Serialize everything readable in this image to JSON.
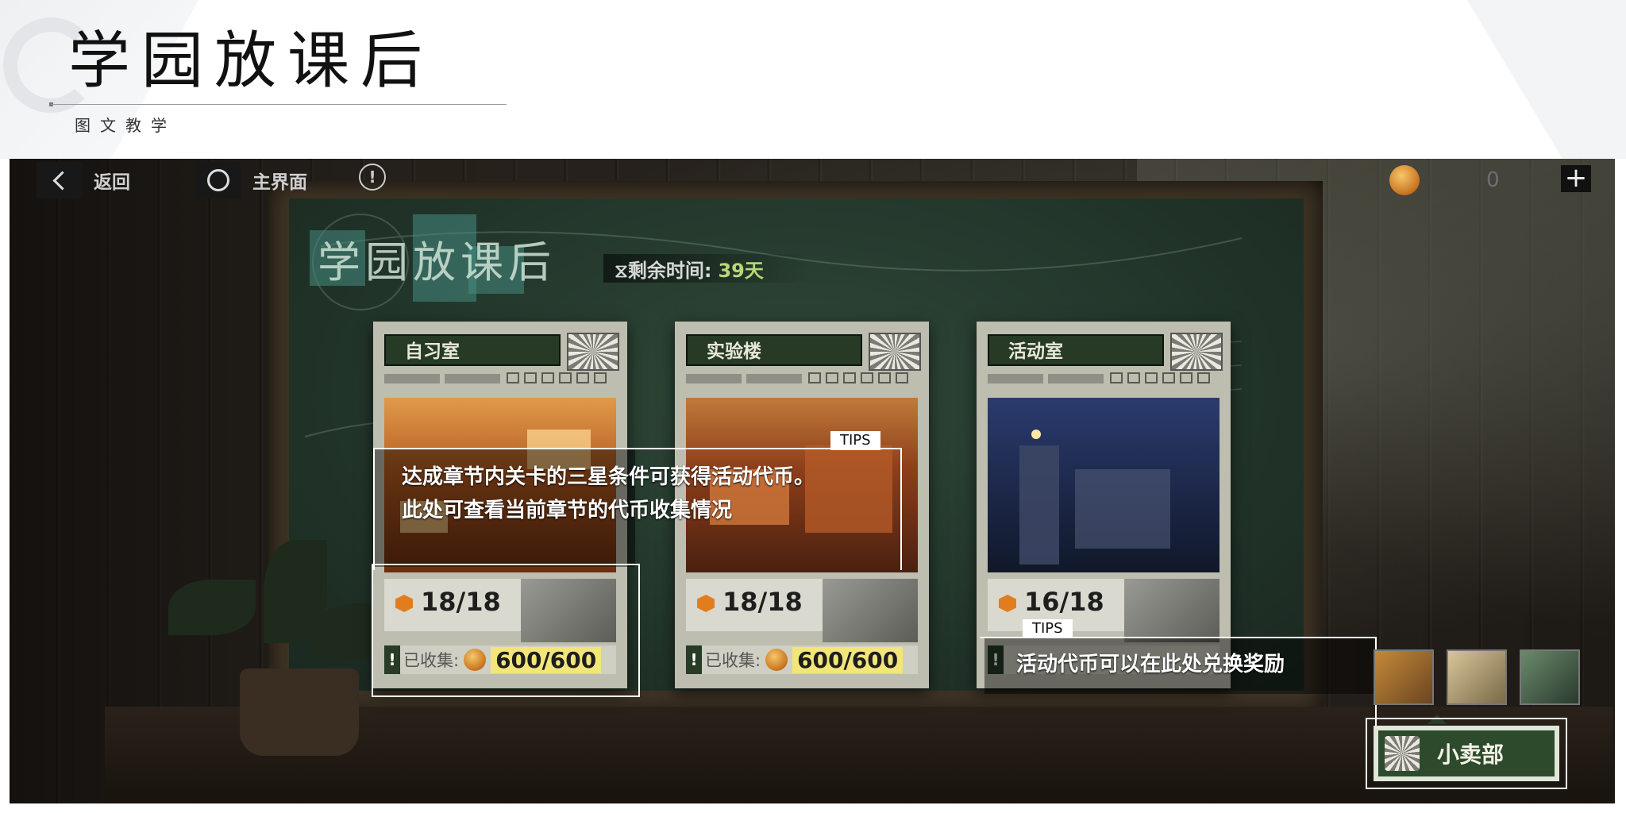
{
  "slide": {
    "title": "学园放课后",
    "subtitle": "图文教学"
  },
  "nav": {
    "back_label": "返回",
    "home_label": "主界面",
    "info_icon": "!",
    "coin_count": "0",
    "plus": "+"
  },
  "board": {
    "logo_text": "学园放课后",
    "remaining_label": "⧖剩余时间:",
    "remaining_value": "39天"
  },
  "chapters": [
    {
      "name": "自习室",
      "progress": "18/18",
      "collect_label": "已收集:",
      "collect_value": "600/600"
    },
    {
      "name": "实验楼",
      "progress": "18/18",
      "collect_label": "已收集:",
      "collect_value": "600/600"
    },
    {
      "name": "活动室",
      "progress": "16/18"
    }
  ],
  "tips": [
    {
      "tag": "TIPS",
      "lines": [
        "达成章节内关卡的三星条件可获得活动代币。",
        "此处可查看当前章节的代币收集情况"
      ]
    },
    {
      "tag": "TIPS",
      "lines": [
        "活动代币可以在此处兑换奖励"
      ]
    }
  ],
  "shop": {
    "label": "小卖部"
  },
  "colors": {
    "board_green": "#2f4838",
    "card_header": "#263a26",
    "coin_orange": "#c8731f",
    "remaining_value": "#b8d878",
    "highlight_border": "#ffffff"
  },
  "icons": [
    "back-chevron-icon",
    "home-ring-icon",
    "info-icon",
    "coin-icon",
    "plus-icon",
    "hex-star-icon",
    "exclaim-icon",
    "shop-icon"
  ]
}
